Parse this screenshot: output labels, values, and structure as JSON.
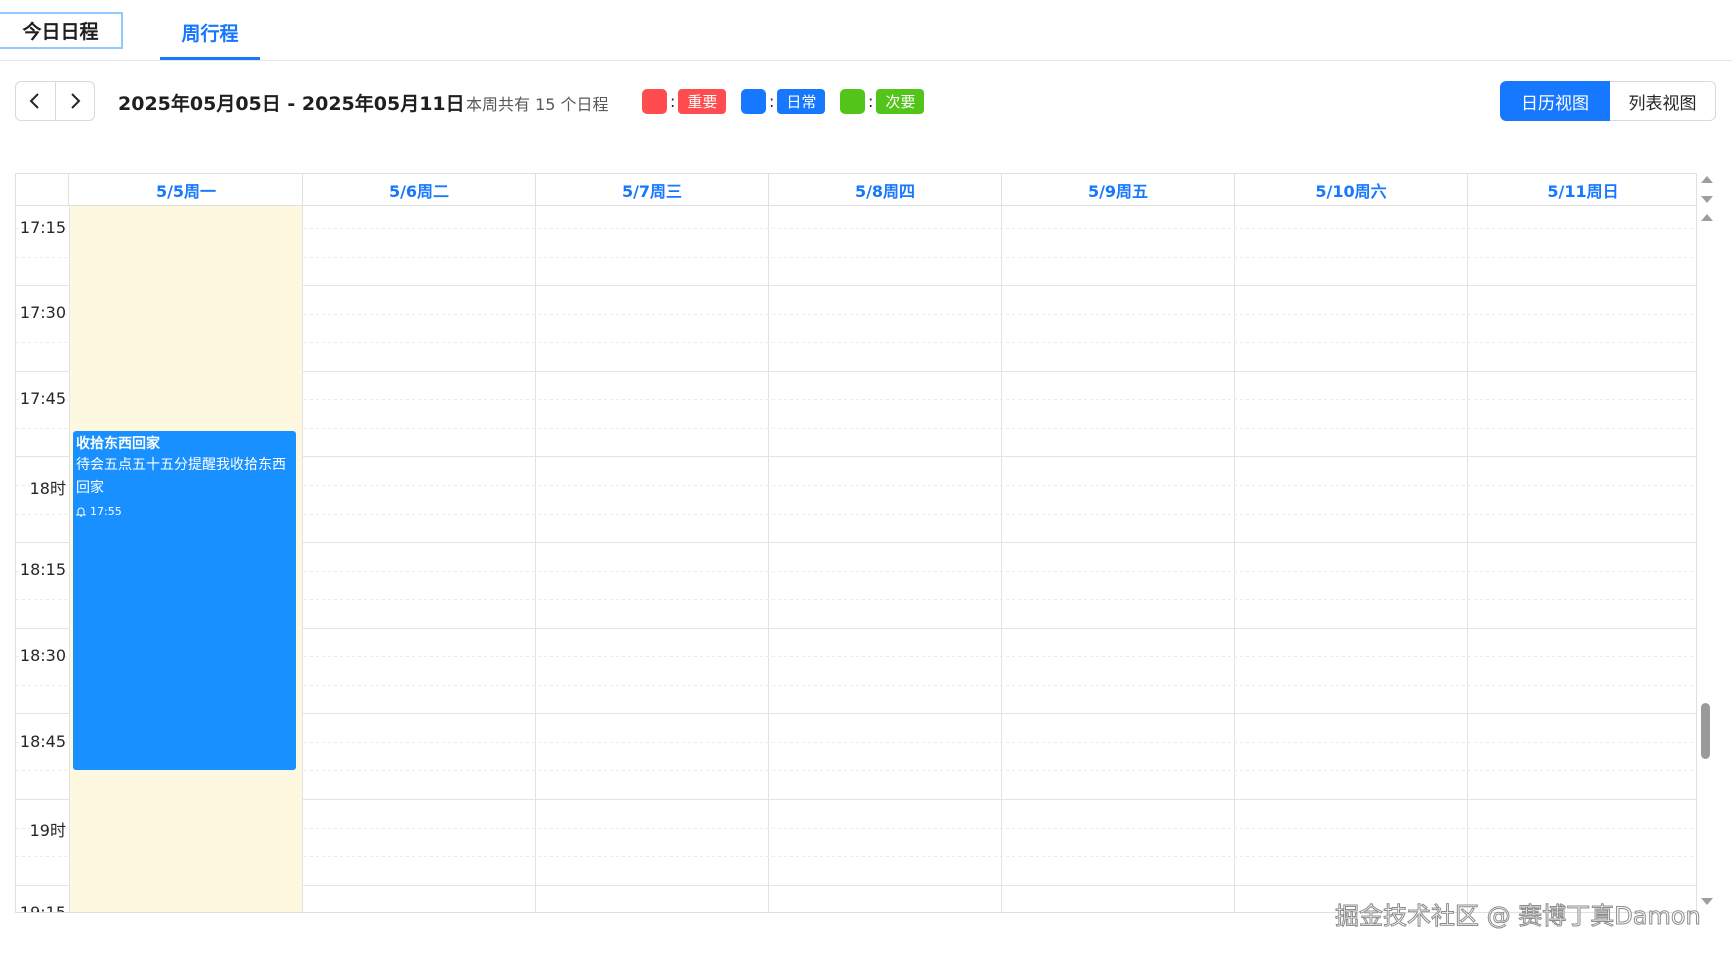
{
  "tabs": {
    "today": "今日日程",
    "week": "周行程"
  },
  "toolbar": {
    "prev_icon": "chevron-left-icon",
    "next_icon": "chevron-right-icon",
    "date_range": "2025年05月05日 - 2025年05月11日",
    "week_count": "本周共有 15 个日程",
    "legend": [
      {
        "color": "#ff4d4f",
        "label": "重要"
      },
      {
        "color": "#1677ff",
        "label": "日常"
      },
      {
        "color": "#52c41a",
        "label": "次要"
      }
    ],
    "views": {
      "calendar": "日历视图",
      "list": "列表视图"
    }
  },
  "calendar": {
    "days": [
      "5/5周一",
      "5/6周二",
      "5/7周三",
      "5/8周四",
      "5/9周五",
      "5/10周六",
      "5/11周日"
    ],
    "times": [
      "17:15",
      "17:30",
      "17:45",
      "18时",
      "18:15",
      "18:30",
      "18:45",
      "19时",
      "19:15"
    ],
    "event": {
      "title": "收拾东西回家",
      "description": "待会五点五十五分提醒我收拾东西回家",
      "reminder_icon": "bell-icon",
      "reminder_time": "17:55",
      "color": "#1890ff"
    },
    "today_highlight": "#fef8e1"
  },
  "watermark": "掘金技术社区 @ 赛博丁真Damon"
}
